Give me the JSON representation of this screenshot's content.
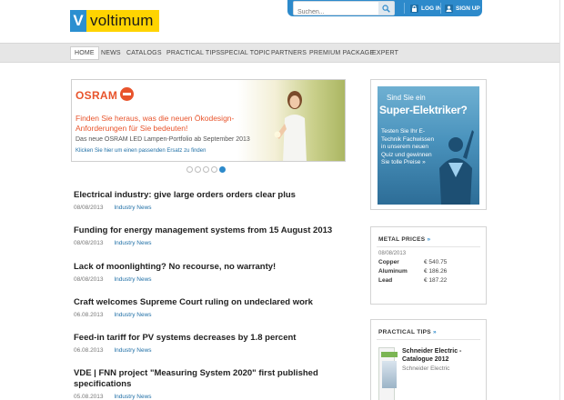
{
  "brand": {
    "logo_letter": "V",
    "logo_text": "voltimum"
  },
  "header": {
    "search_placeholder": "Suchen...",
    "login_label": "LOG IN",
    "signup_label": "SIGN UP"
  },
  "nav": {
    "items": [
      "HOME",
      "NEWS",
      "CATALOGS",
      "PRACTICAL TIPS",
      "SPECIAL TOPIC",
      "PARTNERS",
      "PREMIUM PACKAGE",
      "EXPERT"
    ],
    "active": "HOME"
  },
  "banner": {
    "brand": "OSRAM",
    "headline": "Finden Sie heraus, was die neuen Ökodesign-Anforderungen für Sie bedeuten!",
    "subline": "Das neue OSRAM LED Lampen-Portfolio ab September 2013",
    "link": "Klicken Sie hier um einen passenden Ersatz zu finden",
    "slides": 5,
    "active_slide": 5
  },
  "news": [
    {
      "title": "Electrical industry: give large orders orders clear plus",
      "date": "08/08/2013",
      "category": "Industry News"
    },
    {
      "title": "Funding for energy management systems from 15 August 2013",
      "date": "08/08/2013",
      "category": "Industry News"
    },
    {
      "title": "Lack of moonlighting? No recourse, no warranty!",
      "date": "08/08/2013",
      "category": "Industry News"
    },
    {
      "title": "Craft welcomes Supreme Court ruling on undeclared work",
      "date": "06.08.2013",
      "category": "Industry News"
    },
    {
      "title": "Feed-in tariff for PV systems decreases by 1.8 percent",
      "date": "06.08.2013",
      "category": "Industry News"
    },
    {
      "title": "VDE | FNN project \"Measuring System 2020\" first published specifications",
      "date": "05.08.2013",
      "category": "Industry News"
    }
  ],
  "ad": {
    "line1": "Sind Sie ein",
    "line2": "Super-Elektriker?",
    "body": "Testen Sie Ihr E-Technik Fachwissen in unserem neuen Quiz und gewinnen Sie tolle Preise »"
  },
  "metal_prices": {
    "title": "METAL PRICES",
    "arrow": "»",
    "date": "08/08/2013",
    "rows": [
      {
        "name": "Copper",
        "value": "€ 540.75"
      },
      {
        "name": "Aluminum",
        "value": "€ 186.26"
      },
      {
        "name": "Lead",
        "value": "€ 187.22"
      }
    ]
  },
  "practical_tips": {
    "title": "PRACTICAL TIPS",
    "arrow": "»",
    "item_title": "Schneider Electric - Catalogue 2012",
    "item_sub": "Schneider Electric"
  },
  "colors": {
    "accent": "#2d8acb",
    "logo_yellow": "#ffd400",
    "osram": "#e8542c",
    "nav_bg": "#e6e6e6"
  }
}
